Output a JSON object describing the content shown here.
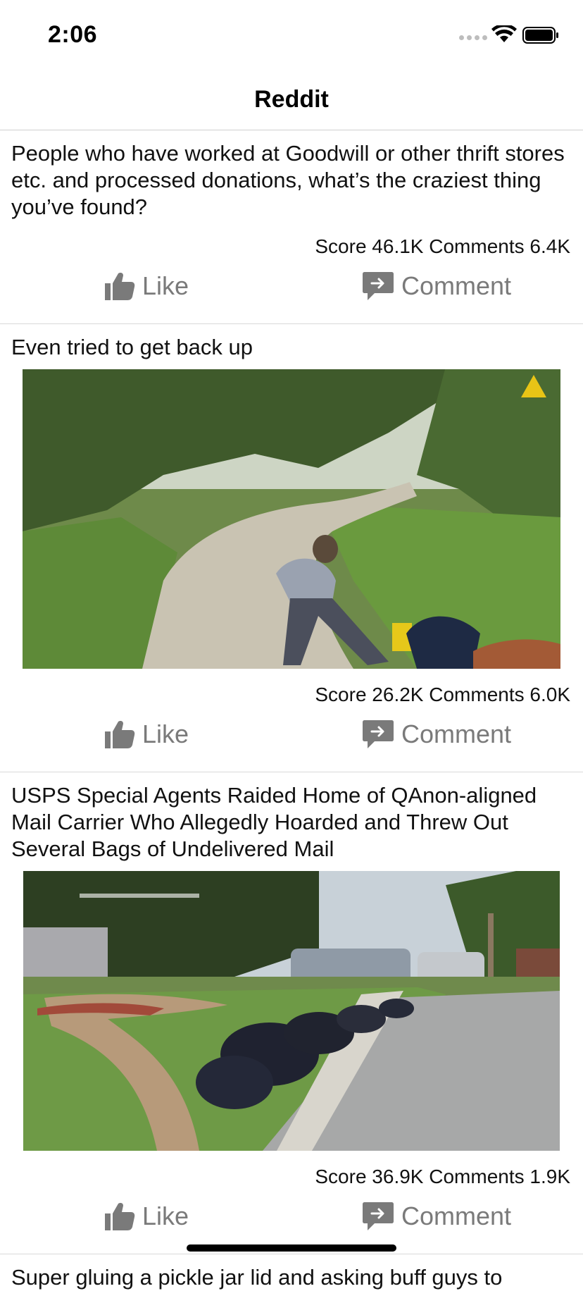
{
  "status_bar": {
    "time": "2:06"
  },
  "nav": {
    "title": "Reddit"
  },
  "posts": [
    {
      "title": "People who have worked at Goodwill or other thrift stores etc. and processed donations, what’s the craziest thing you’ve found?",
      "stats": "Score 46.1K Comments 6.4K",
      "like_label": "Like",
      "comment_label": "Comment"
    },
    {
      "title": "Even tried to get back up",
      "stats": "Score 26.2K Comments 6.0K",
      "like_label": "Like",
      "comment_label": "Comment"
    },
    {
      "title": "USPS Special Agents Raided Home of QAnon-aligned Mail Carrier Who Allegedly Hoarded and Threw Out Several Bags of Undelivered Mail",
      "stats": "Score 36.9K Comments 1.9K",
      "like_label": "Like",
      "comment_label": "Comment"
    },
    {
      "title": "Super gluing a pickle jar lid and asking buff guys to"
    }
  ],
  "icons": {
    "like": "thumbs-up-icon",
    "comment": "comment-bubble-icon"
  },
  "colors": {
    "action_gray": "#7a7a7a",
    "divider": "#d9d9d9"
  }
}
